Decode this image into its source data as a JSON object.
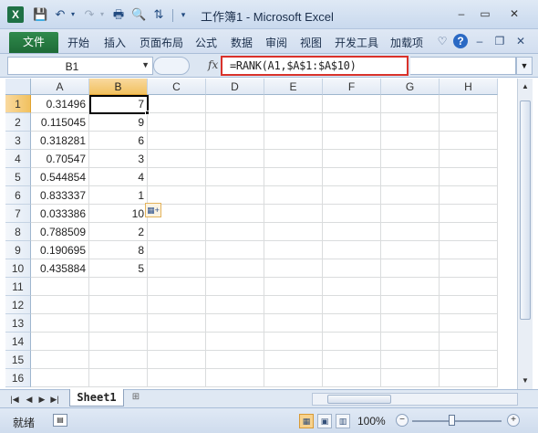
{
  "window": {
    "title": "工作簿1 - Microsoft Excel",
    "app_icon_letter": "X",
    "qa_icons": [
      "save-icon",
      "undo-icon",
      "redo-icon",
      "print-icon",
      "print-preview-icon",
      "sort-icon",
      "customize-qa-icon"
    ],
    "controls": {
      "minimize": "–",
      "restore": "▭",
      "close": "✕"
    }
  },
  "ribbon": {
    "file_tab": "文件",
    "tabs": [
      "开始",
      "插入",
      "页面布局",
      "公式",
      "数据",
      "审阅",
      "视图",
      "开发工具",
      "加载项"
    ],
    "help_glyph": "?"
  },
  "formula_bar": {
    "name_box": "B1",
    "fx_label": "fx",
    "formula": "=RANK(A1,$A$1:$A$10)"
  },
  "sheet": {
    "columns": [
      "A",
      "B",
      "C",
      "D",
      "E",
      "F",
      "G",
      "H"
    ],
    "row_numbers": [
      "1",
      "2",
      "3",
      "4",
      "5",
      "6",
      "7",
      "8",
      "9",
      "10",
      "11",
      "12",
      "13",
      "14",
      "15",
      "16"
    ],
    "col_a": [
      "0.31496",
      "0.115045",
      "0.318281",
      "0.70547",
      "0.544854",
      "0.833337",
      "0.033386",
      "0.788509",
      "0.190695",
      "0.435884"
    ],
    "col_b": [
      "7",
      "9",
      "6",
      "3",
      "4",
      "1",
      "10",
      "2",
      "8",
      "5"
    ],
    "selected_cell": "B1"
  },
  "sheet_tabs": {
    "nav": [
      "|◀",
      "◀",
      "▶",
      "▶|"
    ],
    "active_sheet": "Sheet1"
  },
  "status": {
    "ready": "就绪",
    "zoom": "100%",
    "zoom_minus": "−",
    "zoom_plus": "+"
  }
}
